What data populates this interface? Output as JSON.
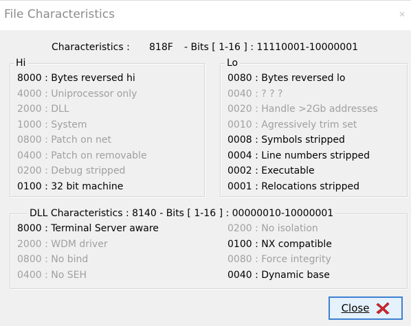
{
  "window": {
    "title": "File Characteristics"
  },
  "characteristics": {
    "label": "Characteristics :",
    "value": "818F",
    "bits": "-  Bits [ 1-16 ] : 11110001-10000001"
  },
  "hi": {
    "legend": "Hi",
    "items": [
      {
        "text": "8000 : Bytes reversed hi",
        "enabled": true
      },
      {
        "text": "4000 : Uniprocessor only",
        "enabled": false
      },
      {
        "text": "2000 : DLL",
        "enabled": false
      },
      {
        "text": "1000 : System",
        "enabled": false
      },
      {
        "text": "0800 : Patch on net",
        "enabled": false
      },
      {
        "text": "0400 : Patch on removable",
        "enabled": false
      },
      {
        "text": "0200 : Debug stripped",
        "enabled": false
      },
      {
        "text": "0100 : 32 bit machine",
        "enabled": true
      }
    ]
  },
  "lo": {
    "legend": "Lo",
    "items": [
      {
        "text": "0080 : Bytes reversed lo",
        "enabled": true
      },
      {
        "text": "0040 : ? ? ?",
        "enabled": false
      },
      {
        "text": "0020 : Handle >2Gb addresses",
        "enabled": false
      },
      {
        "text": "0010 : Agressively trim set",
        "enabled": false
      },
      {
        "text": "0008 : Symbols stripped",
        "enabled": true
      },
      {
        "text": "0004 : Line numbers stripped",
        "enabled": true
      },
      {
        "text": "0002 : Executable",
        "enabled": true
      },
      {
        "text": "0001 : Relocations stripped",
        "enabled": true
      }
    ]
  },
  "dll": {
    "legend": "DLL Characteristics :  8140   -  Bits [ 1-16 ] : 00000010-10000001",
    "left": [
      {
        "text": "8000 : Terminal Server aware",
        "enabled": true
      },
      {
        "text": "2000 : WDM driver",
        "enabled": false
      },
      {
        "text": "0800 : No bind",
        "enabled": false
      },
      {
        "text": "0400 : No SEH",
        "enabled": false
      }
    ],
    "right": [
      {
        "text": "0200 : No isolation",
        "enabled": false
      },
      {
        "text": "0100 : NX compatible",
        "enabled": true
      },
      {
        "text": "0080 : Force integrity",
        "enabled": false
      },
      {
        "text": "0040 : Dynamic base",
        "enabled": true
      }
    ]
  },
  "buttons": {
    "close_label": "Close",
    "close_icon": "red-x-icon"
  },
  "colors": {
    "enabled_text": "#000000",
    "disabled_text": "#a0a0a0",
    "button_border": "#3c7fd0",
    "button_fill": "#e5f1fb",
    "close_icon": "#d8262c"
  }
}
